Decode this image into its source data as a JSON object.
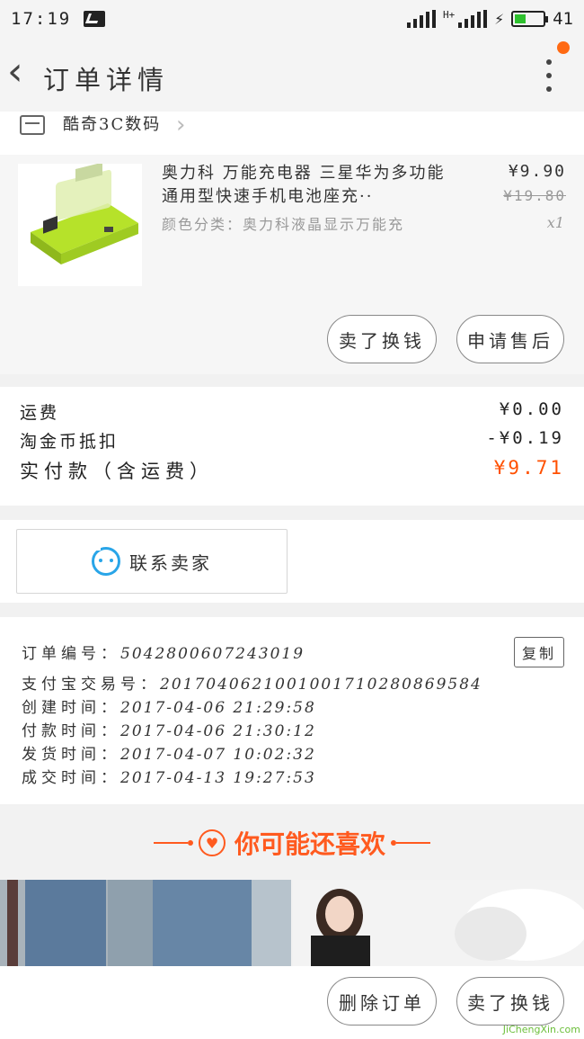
{
  "status_bar": {
    "time": "17:19",
    "net_type": "H+",
    "battery": "41",
    "battery_level": 0.41
  },
  "header": {
    "title": "订单详情"
  },
  "shop": {
    "name": "酷奇3C数码"
  },
  "product": {
    "title": "奥力科 万能充电器 三星华为多功能通用型快速手机电池座充··",
    "sku": "颜色分类：奥力科液晶显示万能充",
    "price": "¥9.90",
    "original_price": "¥19.80",
    "quantity": "x1",
    "actions": [
      "卖了换钱",
      "申请售后"
    ]
  },
  "fees": [
    {
      "label": "运费",
      "value": "¥0.00"
    },
    {
      "label": "淘金币抵扣",
      "value": "-¥0.19"
    },
    {
      "label": "实付款（含运费）",
      "value": "¥9.71"
    }
  ],
  "contact": {
    "label": "联系卖家"
  },
  "order_info": {
    "copy_label": "复制",
    "lines": [
      {
        "key": "订单编号：",
        "value": "5042800607243019"
      },
      {
        "key": "支付宝交易号：",
        "value": "2017040621001001710280869584"
      },
      {
        "key": "创建时间：",
        "value": "2017-04-06 21:29:58"
      },
      {
        "key": "付款时间：",
        "value": "2017-04-06 21:30:12"
      },
      {
        "key": "发货时间：",
        "value": "2017-04-07 10:02:32"
      },
      {
        "key": "成交时间：",
        "value": "2017-04-13 19:27:53"
      }
    ]
  },
  "recommend": {
    "title": "你可能还喜欢"
  },
  "bottom_actions": [
    "删除订单",
    "卖了换钱"
  ],
  "watermark": "JiChengXin.com",
  "colors": {
    "accent": "#ff5000",
    "contact_blue": "#29a5e8",
    "product_green": "#b6e22a"
  }
}
